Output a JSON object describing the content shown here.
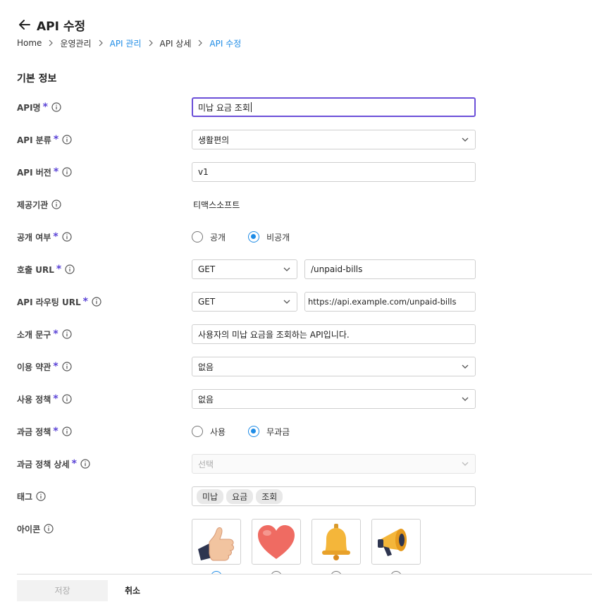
{
  "header": {
    "title": "API 수정",
    "breadcrumb": [
      "Home",
      "운영관리",
      "API 관리",
      "API 상세",
      "API 수정"
    ]
  },
  "section_title": "기본 정보",
  "fields": {
    "api_name": {
      "label": "API명",
      "value": "미납 요금 조회"
    },
    "api_category": {
      "label": "API 분류",
      "value": "생활편의"
    },
    "api_version": {
      "label": "API 버전",
      "value": "v1"
    },
    "provider": {
      "label": "제공기관",
      "value": "티맥스소프트"
    },
    "visibility": {
      "label": "공개 여부",
      "options": [
        "공개",
        "비공개"
      ],
      "selected": "비공개"
    },
    "call_url": {
      "label": "호출 URL",
      "method": "GET",
      "value": "/unpaid-bills"
    },
    "routing_url": {
      "label": "API 라우팅 URL",
      "method": "GET",
      "value": "https://api.example.com/unpaid-bills"
    },
    "description": {
      "label": "소개 문구",
      "value": "사용자의 미납 요금을 조회하는 API입니다."
    },
    "terms": {
      "label": "이용 약관",
      "value": "없음"
    },
    "usage_policy": {
      "label": "사용 정책",
      "value": "없음"
    },
    "billing_policy": {
      "label": "과금 정책",
      "options": [
        "사용",
        "무과금"
      ],
      "selected": "무과금"
    },
    "billing_detail": {
      "label": "과금 정책 상세",
      "placeholder": "선택"
    },
    "tags": {
      "label": "태그",
      "items": [
        "미납",
        "요금",
        "조회"
      ]
    },
    "icon": {
      "label": "아이콘",
      "choices": [
        "thumbs-up-icon",
        "heart-icon",
        "bell-icon",
        "megaphone-icon"
      ]
    }
  },
  "footer": {
    "save_label": "저장",
    "cancel_label": "취소"
  },
  "colors": {
    "accent": "#6b4fd8",
    "link": "#1f8ce6",
    "required": "#5a43d6"
  }
}
